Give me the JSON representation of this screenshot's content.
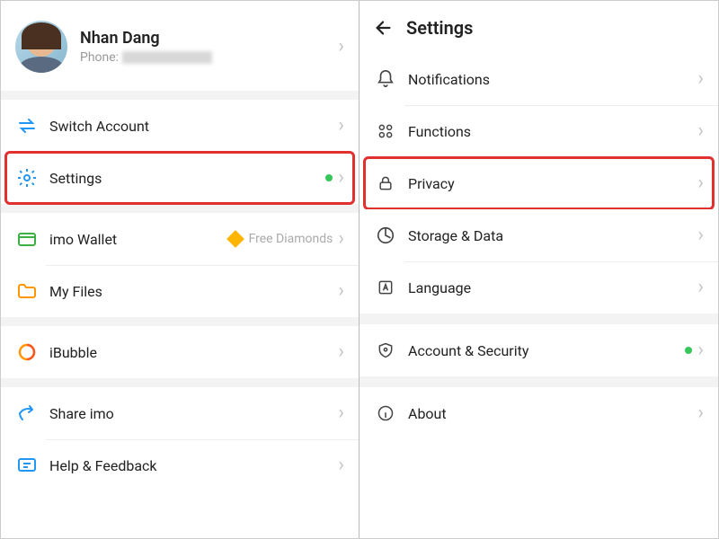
{
  "left": {
    "profile": {
      "name": "Nhan Dang",
      "phone_label": "Phone:"
    },
    "items": {
      "switch": "Switch Account",
      "settings": "Settings",
      "wallet": "imo Wallet",
      "wallet_badge": "Free Diamonds",
      "files": "My Files",
      "ibubble": "iBubble",
      "share": "Share imo",
      "help": "Help & Feedback"
    }
  },
  "right": {
    "title": "Settings",
    "items": {
      "notifications": "Notifications",
      "functions": "Functions",
      "privacy": "Privacy",
      "storage": "Storage & Data",
      "language": "Language",
      "security": "Account & Security",
      "about": "About"
    }
  }
}
